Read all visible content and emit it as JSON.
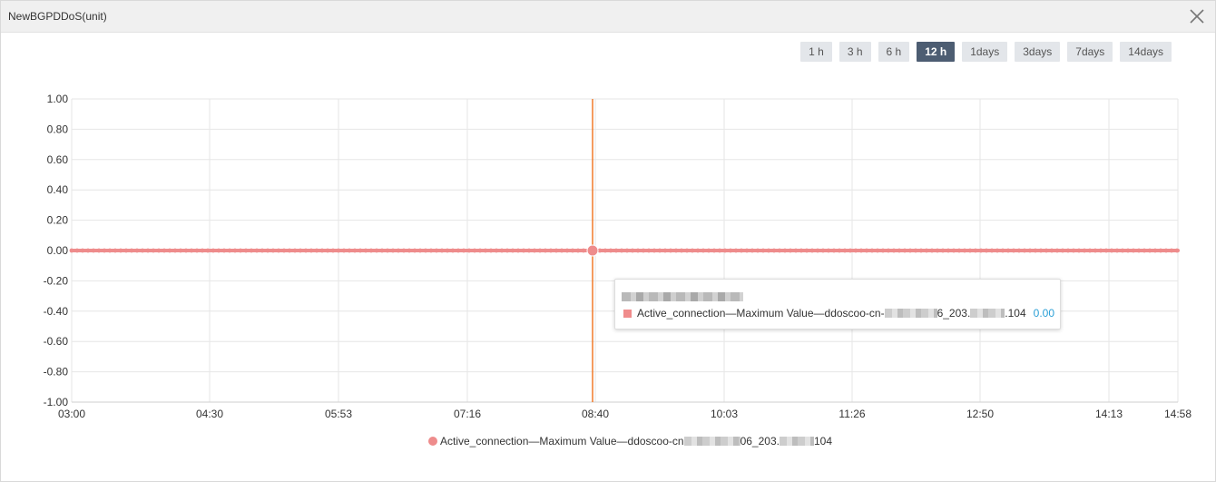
{
  "window": {
    "title": "NewBGPDDoS(unit)",
    "close_icon": "close-icon"
  },
  "time_ranges": [
    {
      "label": "1 h",
      "active": false
    },
    {
      "label": "3 h",
      "active": false
    },
    {
      "label": "6 h",
      "active": false
    },
    {
      "label": "12 h",
      "active": true
    },
    {
      "label": "1days",
      "active": false
    },
    {
      "label": "3days",
      "active": false
    },
    {
      "label": "7days",
      "active": false
    },
    {
      "label": "14days",
      "active": false
    }
  ],
  "tooltip": {
    "label_prefix": "Active_connection—Maximum Value—ddoscoo-cn-",
    "label_mid": "6_203.",
    "label_suffix": ".104",
    "value": "0.00"
  },
  "legend": {
    "prefix": "Active_connection—Maximum Value—ddoscoo-cn",
    "mid": "06_203.",
    "suffix": "104"
  },
  "colors": {
    "series": "#ee8c8c",
    "crosshair": "#f07a2a",
    "active_range": "#4d5d72",
    "tooltip_value": "#2a9fd6"
  },
  "chart_data": {
    "type": "line",
    "title": "",
    "xlabel": "",
    "ylabel": "",
    "ylim": [
      -1.0,
      1.0
    ],
    "y_ticks": [
      "1.00",
      "0.80",
      "0.60",
      "0.40",
      "0.20",
      "0.00",
      "-0.20",
      "-0.40",
      "-0.60",
      "-0.80",
      "-1.00"
    ],
    "x_ticks": [
      "03:00",
      "04:30",
      "05:53",
      "07:16",
      "08:40",
      "10:03",
      "11:26",
      "12:50",
      "14:13",
      "14:58"
    ],
    "grid": true,
    "legend_position": "bottom-center",
    "series": [
      {
        "name": "Active_connection—Maximum Value—ddoscoo-cn…06_203.…104",
        "x": [
          "03:00",
          "04:30",
          "05:53",
          "07:16",
          "08:40",
          "10:03",
          "11:26",
          "12:50",
          "14:13",
          "14:58"
        ],
        "y": [
          0,
          0,
          0,
          0,
          0,
          0,
          0,
          0,
          0,
          0
        ]
      }
    ],
    "crosshair_x": "08:40",
    "highlight_value": 0.0
  }
}
